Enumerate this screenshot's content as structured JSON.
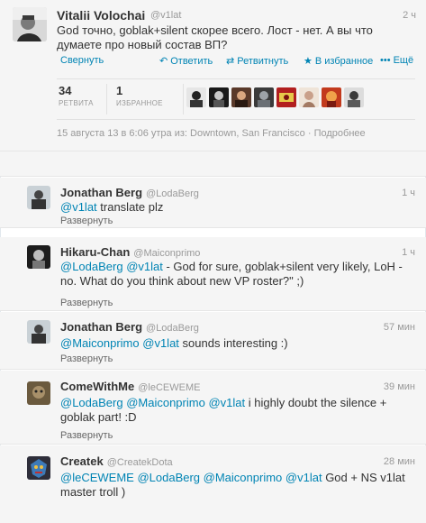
{
  "main": {
    "author_name": "Vitalii Volochai",
    "author_handle": "@v1lat",
    "time": "2 ч",
    "text": "God точно, goblak+silent скорее всего. Лост - нет. А вы что думаете про новый состав ВП?",
    "actions": {
      "collapse": "Свернуть",
      "reply": "Ответить",
      "retweet": "Ретвитнуть",
      "favorite": "В избранное",
      "more": "Ещё"
    },
    "stats": {
      "retweets_count": "34",
      "retweets_label": "РЕТВИТА",
      "favorites_count": "1",
      "favorites_label": "ИЗБРАННОЕ"
    },
    "timestamp": "15 августа 13 в 6:06 утра из: Downtown, San Francisco",
    "details_link": "Подробнее"
  },
  "replies": [
    {
      "name": "Jonathan Berg",
      "handle": "@LodaBerg",
      "time": "1 ч",
      "mentions": [
        "@v1lat"
      ],
      "text": " translate plz",
      "expand": "Развернуть"
    },
    {
      "name": "Hikaru-Chan",
      "handle": "@Maiconprimo",
      "time": "1 ч",
      "mentions": [
        "@LodaBerg",
        "@v1lat"
      ],
      "text": " - God for sure, goblak+silent very likely, LoH - no. What do you think about new VP roster?\" ;)",
      "expand": "Развернуть"
    },
    {
      "name": "Jonathan Berg",
      "handle": "@LodaBerg",
      "time": "57 мин",
      "mentions": [
        "@Maiconprimo",
        "@v1lat"
      ],
      "text": " sounds interesting :)",
      "expand": "Развернуть"
    },
    {
      "name": "ComeWithMe",
      "handle": "@leCEWEME",
      "time": "39 мин",
      "mentions": [
        "@LodaBerg",
        "@Maiconprimo",
        "@v1lat"
      ],
      "text": " i highly doubt the silence + goblak part! :D",
      "expand": "Развернуть"
    },
    {
      "name": "Createk",
      "handle": "@CreatekDota",
      "time": "28 мин",
      "mentions": [
        "@leCEWEME",
        "@LodaBerg",
        "@Maiconprimo",
        "@v1lat"
      ],
      "text": " God + NS v1lat master troll )",
      "expand": ""
    }
  ],
  "colors": {
    "link": "#0084b4",
    "background": "#f5f5f5",
    "muted": "#999999"
  }
}
